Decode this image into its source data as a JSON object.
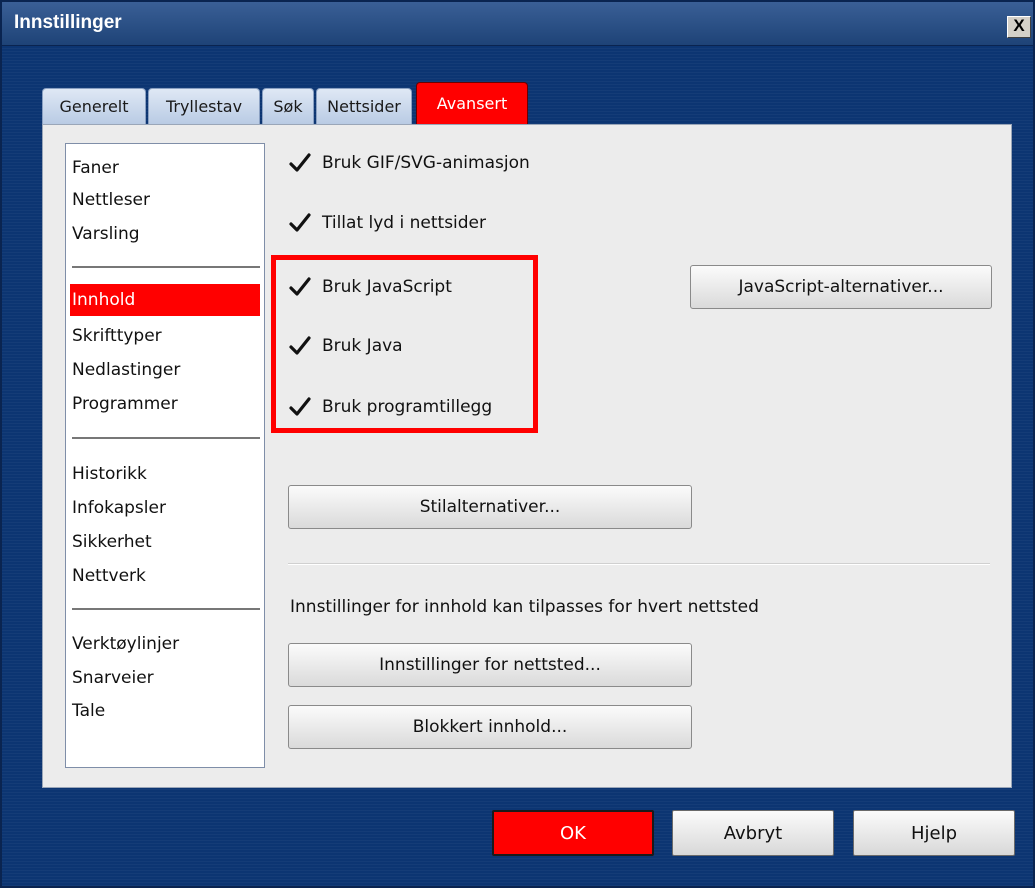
{
  "window": {
    "title": "Innstillinger",
    "close_label": "X"
  },
  "tabs": [
    {
      "label": "Generelt",
      "active": false
    },
    {
      "label": "Tryllestav",
      "active": false
    },
    {
      "label": "Søk",
      "active": false
    },
    {
      "label": "Nettsider",
      "active": false
    },
    {
      "label": "Avansert",
      "active": true
    }
  ],
  "sidebar": {
    "items": [
      {
        "label": "Faner"
      },
      {
        "label": "Nettleser"
      },
      {
        "label": "Varsling"
      },
      {
        "label": "Innhold",
        "selected": true
      },
      {
        "label": "Skrifttyper"
      },
      {
        "label": "Nedlastinger"
      },
      {
        "label": "Programmer"
      },
      {
        "label": "Historikk"
      },
      {
        "label": "Infokapsler"
      },
      {
        "label": "Sikkerhet"
      },
      {
        "label": "Nettverk"
      },
      {
        "label": "Verktøylinjer"
      },
      {
        "label": "Snarveier"
      },
      {
        "label": "Tale"
      }
    ]
  },
  "content": {
    "checkboxes": [
      {
        "label": "Bruk GIF/SVG-animasjon",
        "checked": true
      },
      {
        "label": "Tillat lyd i nettsider",
        "checked": true
      },
      {
        "label": "Bruk JavaScript",
        "checked": true
      },
      {
        "label": "Bruk Java",
        "checked": true
      },
      {
        "label": "Bruk programtillegg",
        "checked": true
      }
    ],
    "javascript_options_label": "JavaScript-alternativer...",
    "style_options_label": "Stilalternativer...",
    "site_info": "Innstillinger for innhold kan tilpasses for hvert nettsted",
    "site_settings_label": "Innstillinger for nettsted...",
    "blocked_content_label": "Blokkert innhold..."
  },
  "footer": {
    "ok_label": "OK",
    "cancel_label": "Avbryt",
    "help_label": "Hjelp"
  },
  "colors": {
    "accent": "#ff0000",
    "window_bg": "#0c3572"
  }
}
